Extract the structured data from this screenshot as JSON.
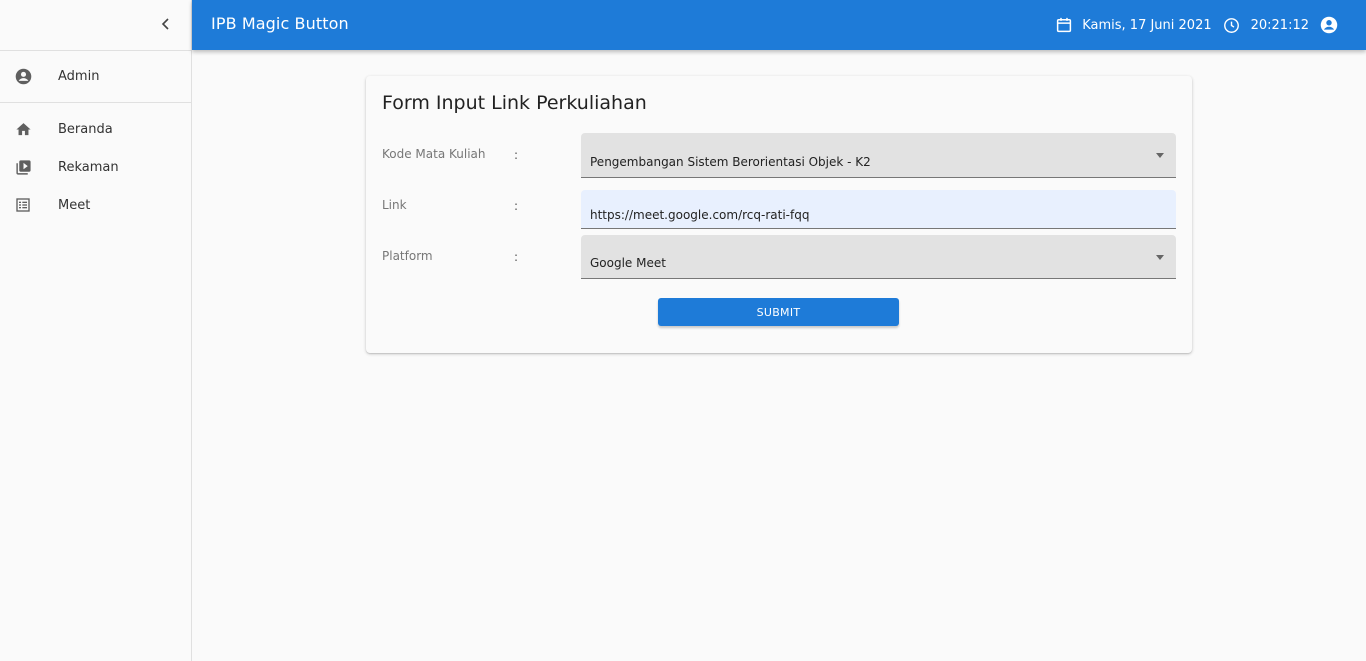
{
  "app": {
    "title": "IPB Magic Button"
  },
  "header": {
    "date": "Kamis, 17 Juni 2021",
    "time": "20:21:12",
    "icons": [
      "calendar-icon",
      "clock-icon",
      "account-circle-icon"
    ],
    "accent_color": "#1e7bd8"
  },
  "sidebar": {
    "collapse_icon": "chevron-left-icon",
    "user": {
      "name": "Admin",
      "icon": "account-circle-icon"
    },
    "items": [
      {
        "label": "Beranda",
        "icon": "home-icon"
      },
      {
        "label": "Rekaman",
        "icon": "video-library-icon"
      },
      {
        "label": "Meet",
        "icon": "list-icon"
      }
    ]
  },
  "form": {
    "title": "Form Input Link Perkuliahan",
    "colon": ":",
    "fields": [
      {
        "label": "Kode Mata Kuliah",
        "value": "Pengembangan Sistem Berorientasi Objek - K2",
        "type": "select"
      },
      {
        "label": "Link",
        "value": "https://meet.google.com/rcq-rati-fqq",
        "type": "text"
      },
      {
        "label": "Platform",
        "value": "Google Meet",
        "type": "select"
      }
    ],
    "submit_label": "SUBMIT"
  }
}
